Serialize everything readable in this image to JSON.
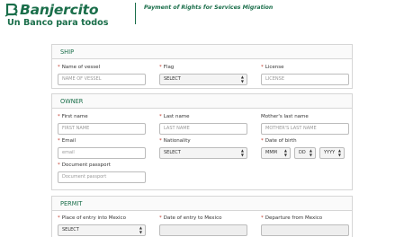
{
  "header": {
    "brand_name": "Banjercito",
    "brand_tagline": "Un Banco para todos",
    "page_title": "Payment of Rights for Services Migration",
    "brand_color": "#1a6e4a"
  },
  "ship": {
    "title": "SHIP",
    "name_of_vessel": {
      "label": "Name of vessel",
      "placeholder": "NAME OF VESSEL"
    },
    "flag": {
      "label": "Flag",
      "value": "SELECT"
    },
    "license": {
      "label": "License",
      "placeholder": "LICENSE"
    }
  },
  "owner": {
    "title": "OWNER",
    "first_name": {
      "label": "First name",
      "placeholder": "FIRST NAME"
    },
    "last_name": {
      "label": "Last name",
      "placeholder": "LAST NAME"
    },
    "mothers_last_name": {
      "label": "Mother's last name",
      "placeholder": "MOTHER'S LAST NAME"
    },
    "email": {
      "label": "Email",
      "placeholder": "email"
    },
    "nationality": {
      "label": "Nationality",
      "value": "SELECT"
    },
    "date_of_birth": {
      "label": "Date of birth",
      "month": "MMM",
      "day": "DD",
      "year": "YYYY"
    },
    "document_passport": {
      "label": "Document passport",
      "placeholder": "Document passport"
    }
  },
  "permit": {
    "title": "PERMIT",
    "place_of_entry": {
      "label": "Place of entry into Mexico",
      "value": "SELECT"
    },
    "date_of_entry": {
      "label": "Date of entry to Mexico"
    },
    "departure": {
      "label": "Departure from Mexico"
    }
  }
}
